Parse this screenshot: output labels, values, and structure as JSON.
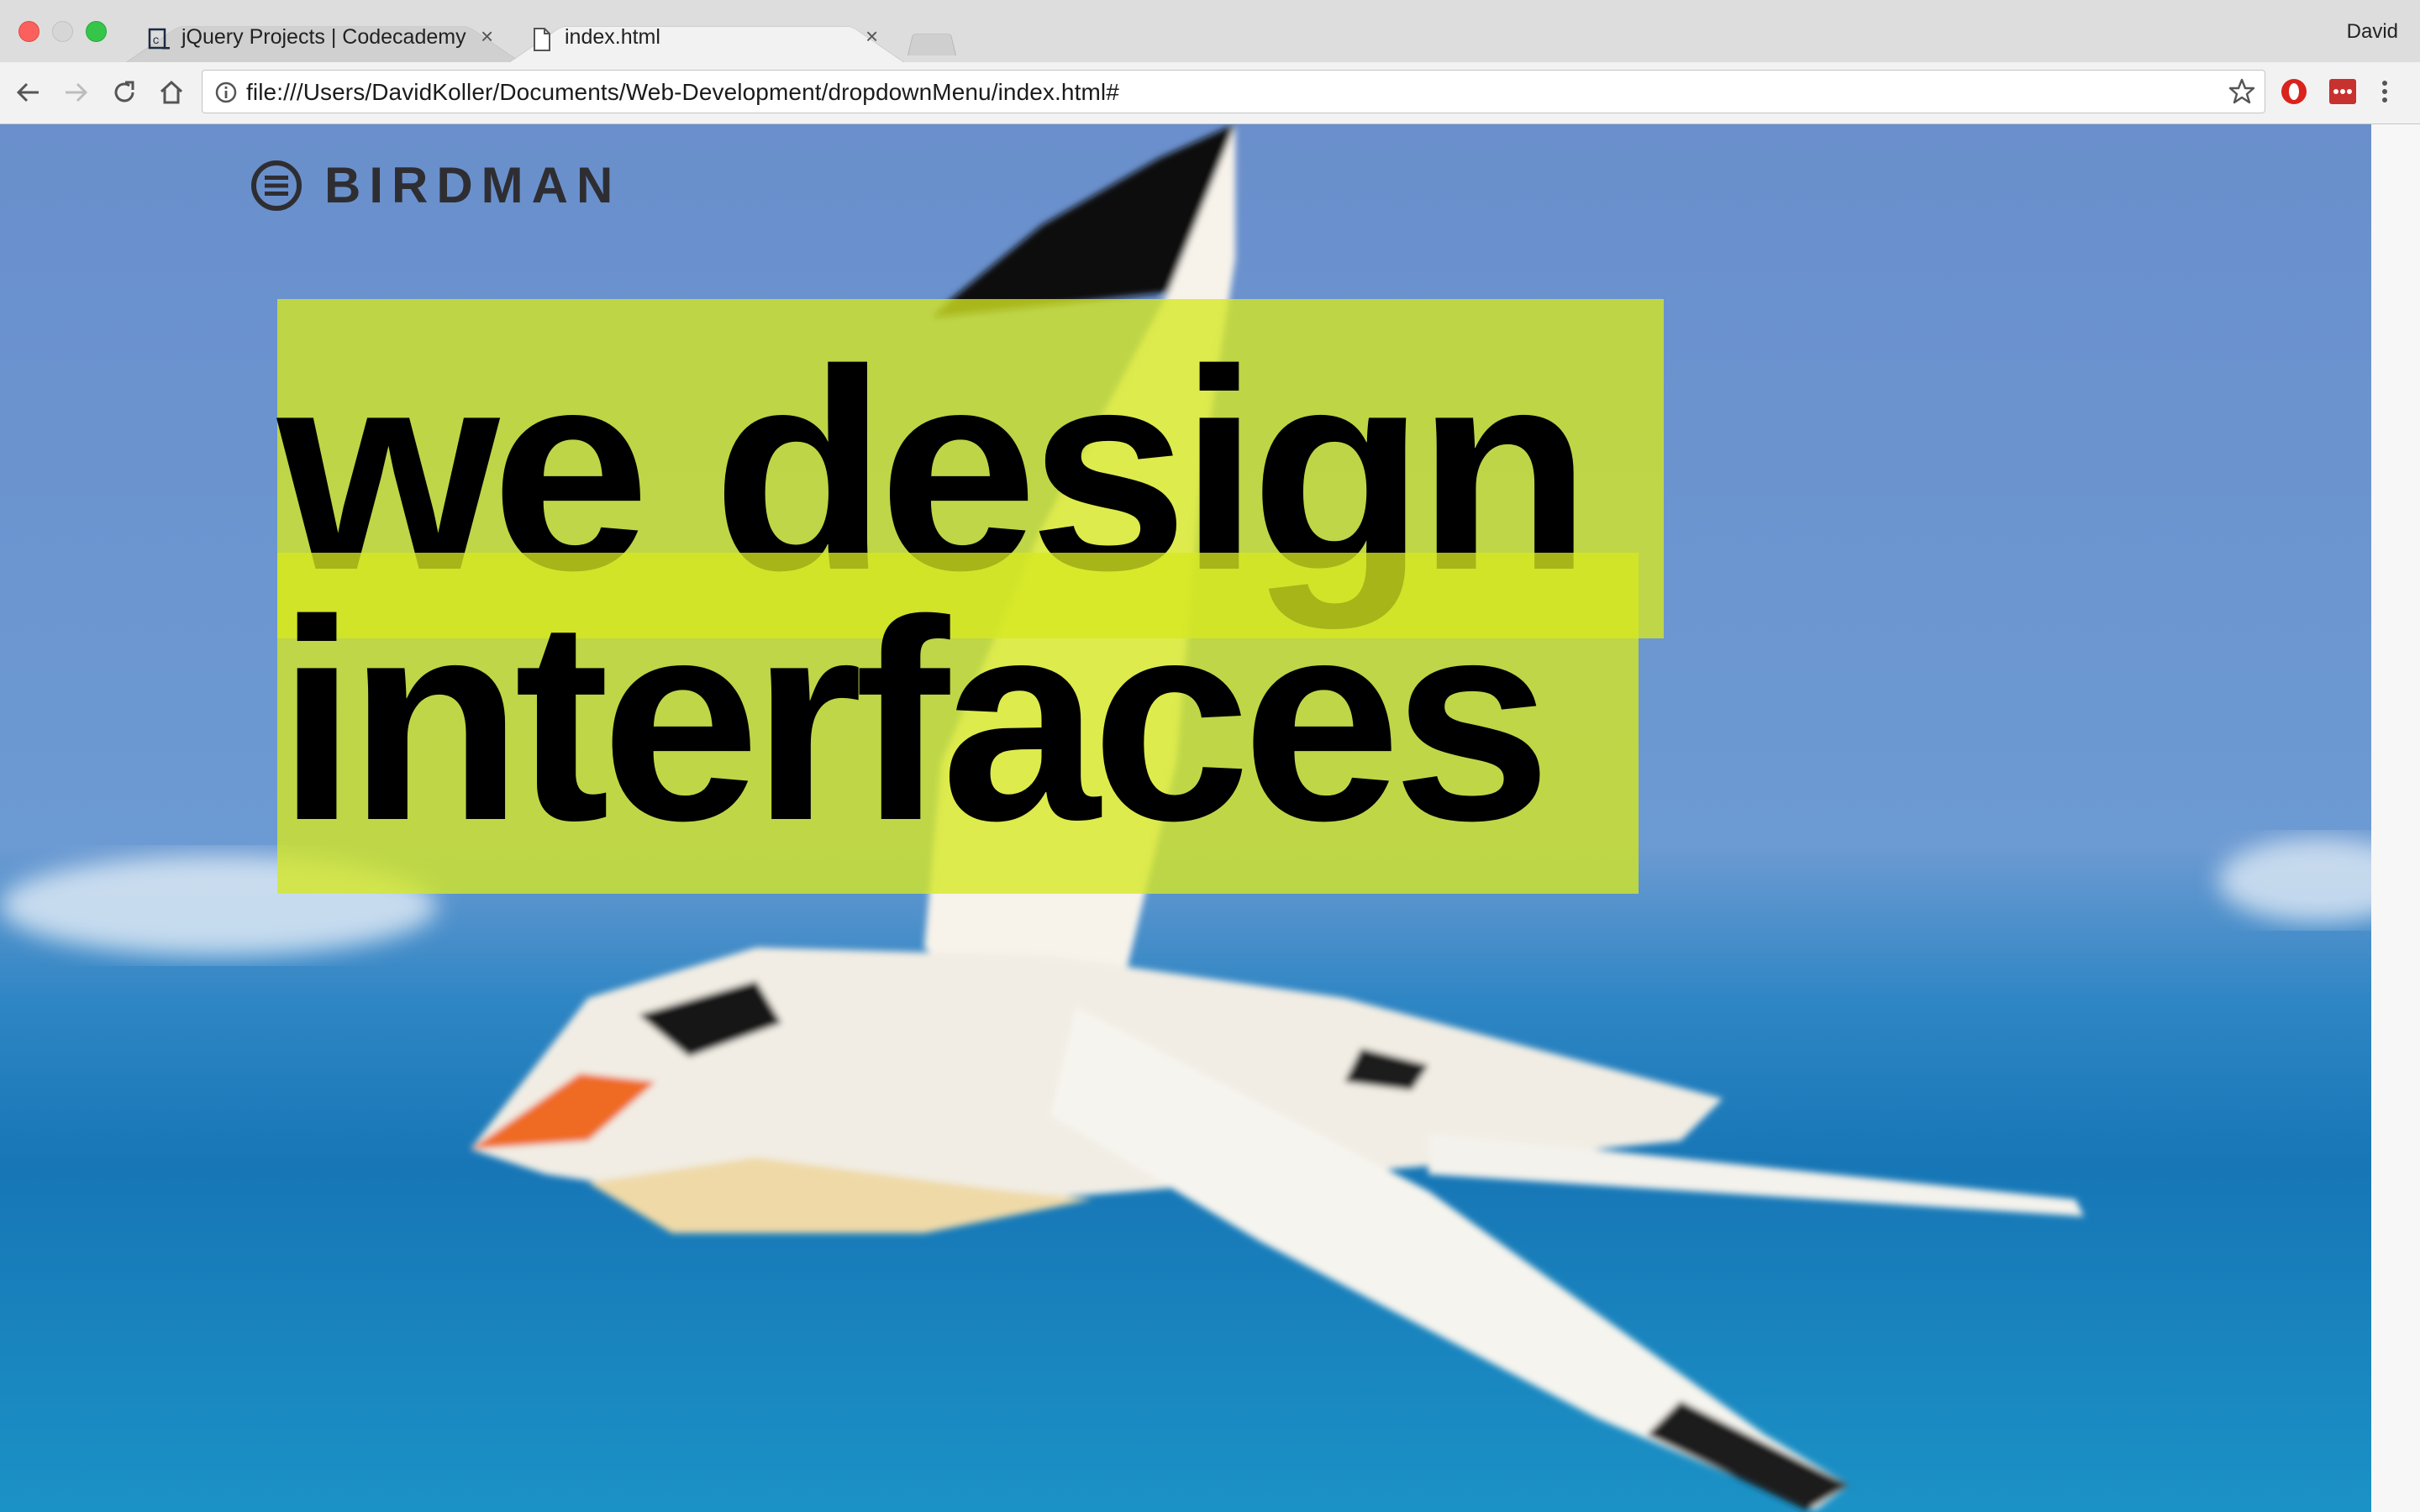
{
  "browser": {
    "tabs": [
      {
        "title": "jQuery Projects | Codecademy",
        "icon": "codecademy-favicon",
        "active": false
      },
      {
        "title": "index.html",
        "icon": "file-icon",
        "active": true
      }
    ],
    "close_glyph": "×",
    "profile_name": "David",
    "address_bar": {
      "url": "file:///Users/DavidKoller/Documents/Web-Development/dropdownMenu/index.html#",
      "icon": "info-icon"
    },
    "nav_icons": [
      "back-arrow-icon",
      "forward-arrow-icon",
      "reload-icon",
      "home-icon"
    ],
    "extension_icons": [
      "opera-extension-icon",
      "lastpass-extension-icon",
      "menu-dots-icon"
    ],
    "colors": {
      "tabstrip": "#dddddd",
      "toolbar": "#f2f2f2"
    }
  },
  "page": {
    "logo_text": "BIRDMAN",
    "logo_icon": "hamburger-circle-icon",
    "headline_line1": "we design",
    "headline_line2": "interfaces",
    "colors": {
      "highlight": "#d6e820",
      "sky": "#6a93cf",
      "sea": "#1b8cc6",
      "text": "#000000",
      "logo": "#2e2e32"
    }
  }
}
